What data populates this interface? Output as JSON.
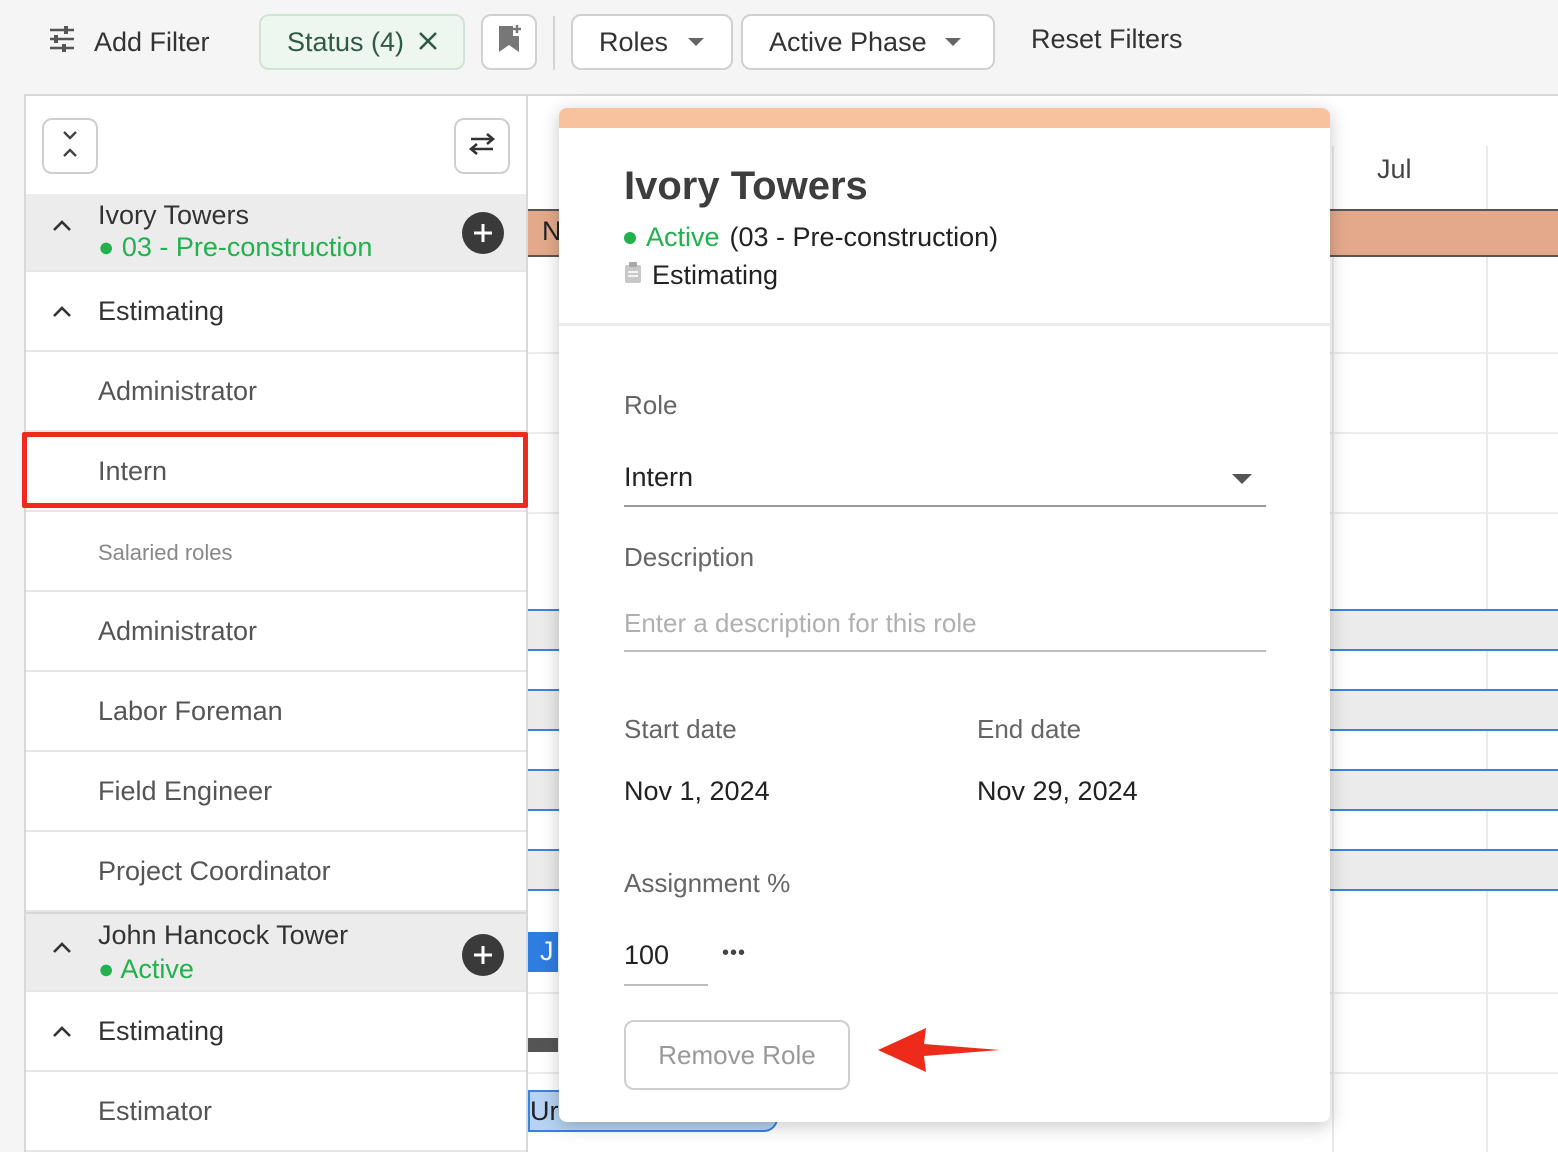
{
  "toolbar": {
    "add_filter_label": "Add Filter",
    "status_chip_label": "Status (4)",
    "roles_label": "Roles",
    "active_phase_label": "Active Phase",
    "reset_filters_label": "Reset Filters"
  },
  "left_panel": {
    "projects": [
      {
        "name": "Ivory Towers",
        "status": "03 - Pre-construction",
        "phase": "Estimating",
        "roles": [
          "Administrator",
          "Intern"
        ],
        "salaried_label": "Salaried roles",
        "salaried_roles": [
          "Administrator",
          "Labor Foreman",
          "Field Engineer",
          "Project Coordinator"
        ]
      },
      {
        "name": "John Hancock Tower",
        "status": "Active",
        "phase": "Estimating",
        "roles": [
          "Estimator"
        ]
      }
    ]
  },
  "timeline": {
    "months": [
      "Jul"
    ],
    "fragments": [
      "N",
      "J",
      "Ur"
    ]
  },
  "popover": {
    "title": "Ivory Towers",
    "status_word": "Active",
    "status_detail": "(03 - Pre-construction)",
    "phase": "Estimating",
    "role_label": "Role",
    "role_value": "Intern",
    "description_label": "Description",
    "description_placeholder": "Enter a description for this role",
    "start_label": "Start date",
    "start_value": "Nov 1, 2024",
    "end_label": "End date",
    "end_value": "Nov 29, 2024",
    "assignment_label": "Assignment %",
    "assignment_value": "100",
    "more_label": "•••",
    "remove_label": "Remove Role"
  },
  "colors": {
    "accent_green": "#22b14c",
    "highlight_red": "#ee2a1b",
    "popover_band": "#f8c29f",
    "timeline_bar": "#e4a98b",
    "assignment_line": "#3a82e0"
  }
}
